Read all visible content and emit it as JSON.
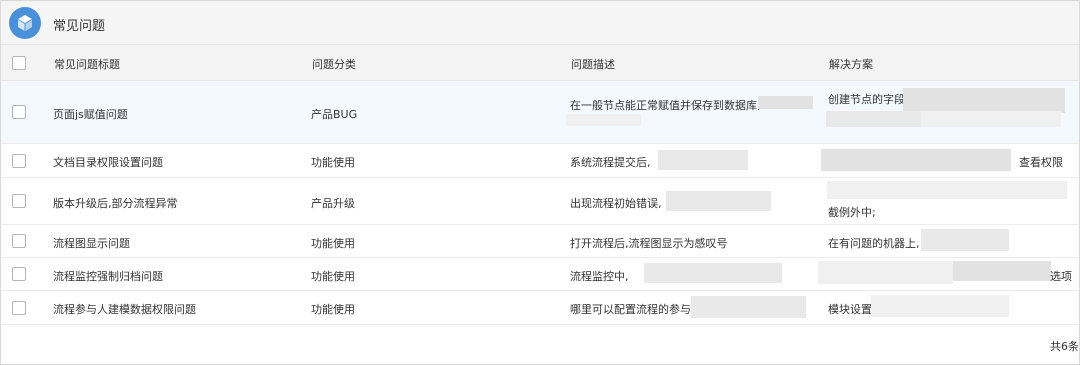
{
  "app": {
    "title": "常见问题",
    "icon": "cube-icon",
    "accent": "#4a90d9"
  },
  "table": {
    "headers": [
      "常见问题标题",
      "问题分类",
      "问题描述",
      "解决方案"
    ],
    "rows": [
      {
        "title": "页面js赋值问题",
        "category": "产品BUG",
        "description": "在一般节点能正常赋值并保存到数据库,",
        "solution": "创建节点的字段J"
      },
      {
        "title": "文档目录权限设置问题",
        "category": "功能使用",
        "description": "系统流程提交后,",
        "solution": "查看权限"
      },
      {
        "title": "版本升级后,部分流程异常",
        "category": "产品升级",
        "description": "出现流程初始错误,",
        "solution": "截例外中;"
      },
      {
        "title": "流程图显示问题",
        "category": "功能使用",
        "description": "打开流程后,流程图显示为感叹号",
        "solution": "在有问题的机器上,"
      },
      {
        "title": "流程监控强制归档问题",
        "category": "功能使用",
        "description": "流程监控中,",
        "solution": "选项"
      },
      {
        "title": "流程参与人建模数据权限问题",
        "category": "功能使用",
        "description": "哪里可以配置流程的参与人",
        "solution": "模块设置"
      }
    ]
  },
  "footer": {
    "count_text": "共6条"
  }
}
